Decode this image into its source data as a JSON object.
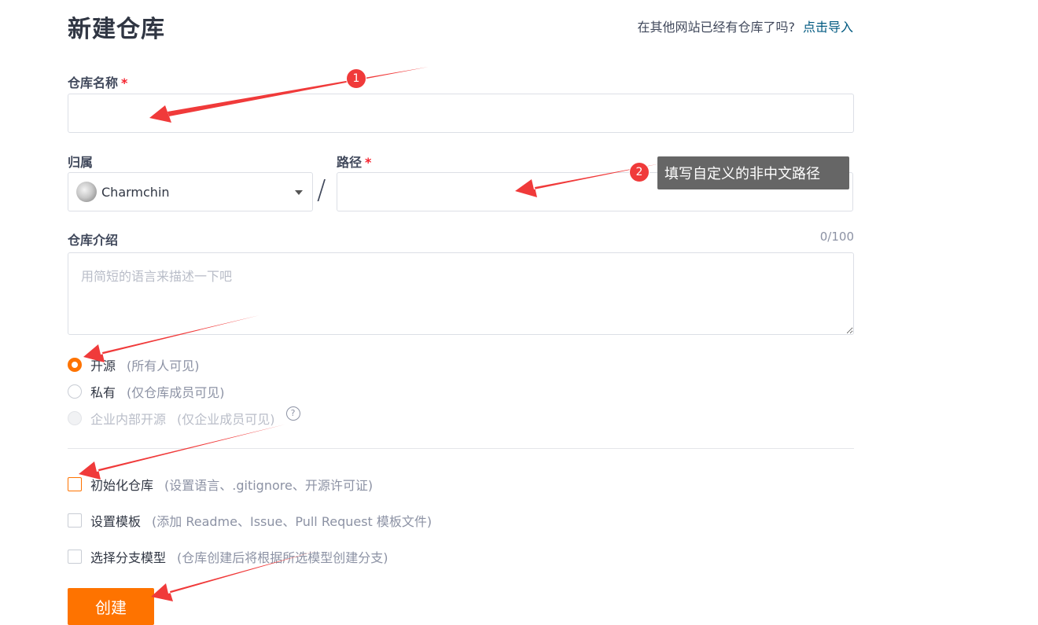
{
  "header": {
    "title": "新建仓库",
    "import_hint": "在其他网站已经有仓库了吗?",
    "import_link": "点击导入"
  },
  "form": {
    "repo_name": {
      "label": "仓库名称",
      "required_mark": "*",
      "value": ""
    },
    "owner": {
      "label": "归属",
      "selected": "Charmchin"
    },
    "separator": "/",
    "path": {
      "label": "路径",
      "required_mark": "*",
      "value": ""
    },
    "description": {
      "label": "仓库介绍",
      "counter": "0/100",
      "placeholder": "用简短的语言来描述一下吧"
    },
    "visibility": [
      {
        "label": "开源",
        "sub": "(所有人可见)",
        "checked": true
      },
      {
        "label": "私有",
        "sub": "(仅仓库成员可见)",
        "checked": false
      },
      {
        "label": "企业内部开源",
        "sub": "(仅企业成员可见)",
        "disabled": true
      }
    ],
    "help_icon": "?",
    "options": [
      {
        "label": "初始化仓库",
        "sub": "(设置语言、.gitignore、开源许可证)",
        "checked": false
      },
      {
        "label": "设置模板",
        "sub": "(添加 Readme、Issue、Pull Request 模板文件)",
        "checked": false
      },
      {
        "label": "选择分支模型",
        "sub": "(仓库创建后将根据所选模型创建分支)",
        "checked": false
      }
    ],
    "submit_label": "创建"
  },
  "annotations": {
    "badge_1": "1",
    "badge_2": "2",
    "tooltip": "填写自定义的非中文路径",
    "arrow_color": "#f03a3a"
  },
  "colors": {
    "accent": "#fe7300",
    "link": "#005980"
  }
}
